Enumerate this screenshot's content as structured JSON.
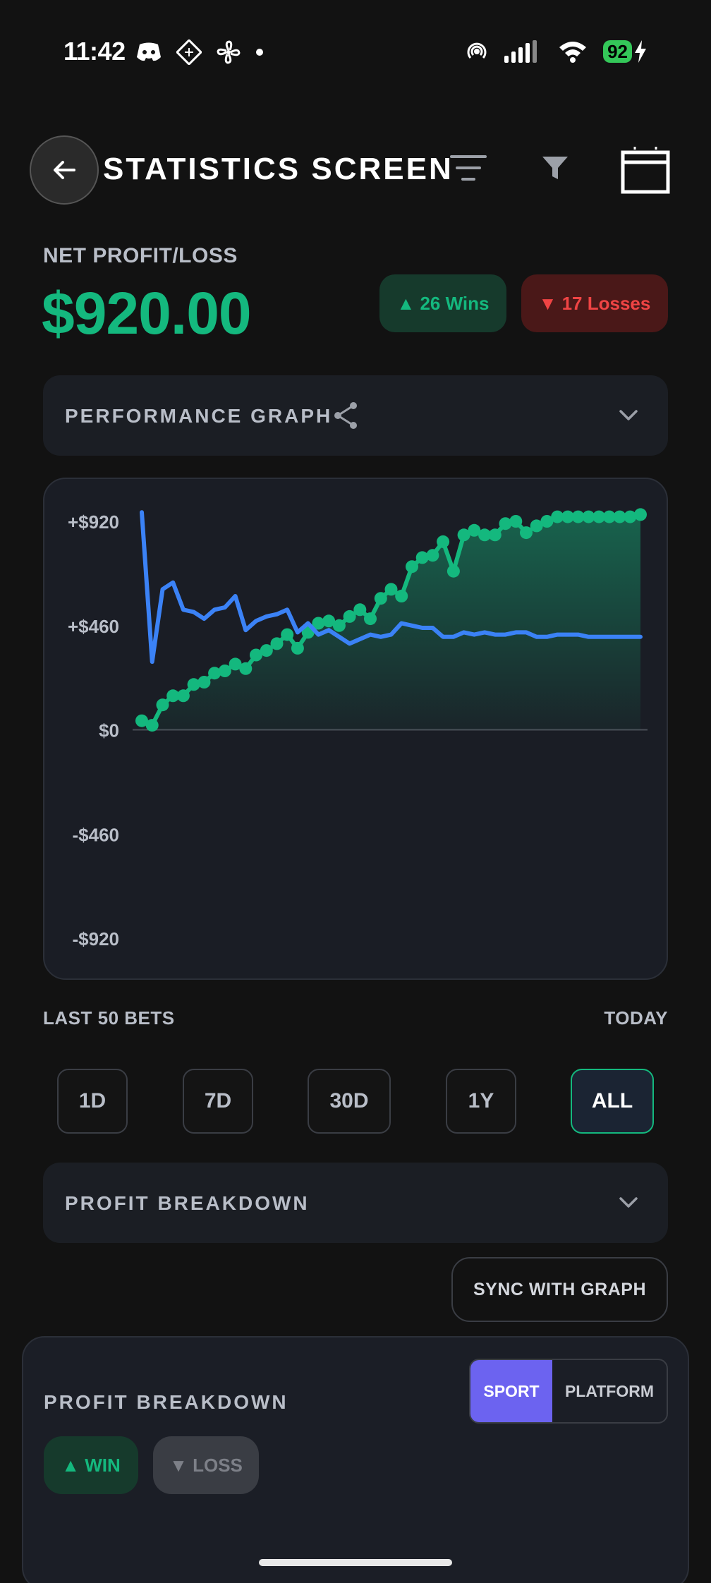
{
  "status_bar": {
    "time": "11:42",
    "battery": "92"
  },
  "header": {
    "title": "STATISTICS SCREEN"
  },
  "net": {
    "label": "NET PROFIT/LOSS",
    "value": "$920.00",
    "wins_label": "▲ 26 Wins",
    "losses_label": "▼ 17 Losses"
  },
  "performance_section": {
    "label": "PERFORMANCE GRAPH"
  },
  "chart_data": {
    "type": "line",
    "y_tick_labels": [
      "+$920",
      "+$460",
      "$0",
      "-$460",
      "-$920"
    ],
    "ylim": [
      -920,
      920
    ],
    "series": [
      {
        "color": "#14b87e",
        "markers": true,
        "filled": true,
        "values": [
          40,
          20,
          110,
          150,
          150,
          200,
          210,
          250,
          260,
          290,
          270,
          330,
          350,
          380,
          420,
          360,
          430,
          470,
          480,
          460,
          500,
          530,
          490,
          580,
          620,
          590,
          720,
          760,
          770,
          830,
          700,
          860,
          880,
          860,
          860,
          910,
          920,
          870,
          900,
          920,
          940,
          940,
          940,
          940,
          940,
          940,
          940,
          940,
          950
        ]
      },
      {
        "color": "#3b82f6",
        "markers": false,
        "filled": false,
        "values": [
          960,
          300,
          620,
          650,
          530,
          520,
          490,
          530,
          540,
          590,
          440,
          480,
          500,
          510,
          530,
          430,
          470,
          420,
          440,
          410,
          380,
          400,
          420,
          410,
          420,
          470,
          460,
          450,
          450,
          410,
          410,
          430,
          420,
          430,
          420,
          420,
          430,
          430,
          410,
          410,
          420,
          420,
          420,
          410,
          410,
          410,
          410,
          410,
          410
        ]
      }
    ]
  },
  "range": {
    "left": "LAST 50 BETS",
    "right": "TODAY"
  },
  "timeframes": [
    "1D",
    "7D",
    "30D",
    "1Y",
    "ALL"
  ],
  "profit_section": {
    "label": "PROFIT BREAKDOWN"
  },
  "sync_button": "SYNC WITH GRAPH",
  "breakdown_card": {
    "title": "PROFIT BREAKDOWN",
    "seg_sport": "SPORT",
    "seg_platform": "PLATFORM",
    "chip_win": "▲ WIN",
    "chip_loss": "▼ LOSS"
  }
}
